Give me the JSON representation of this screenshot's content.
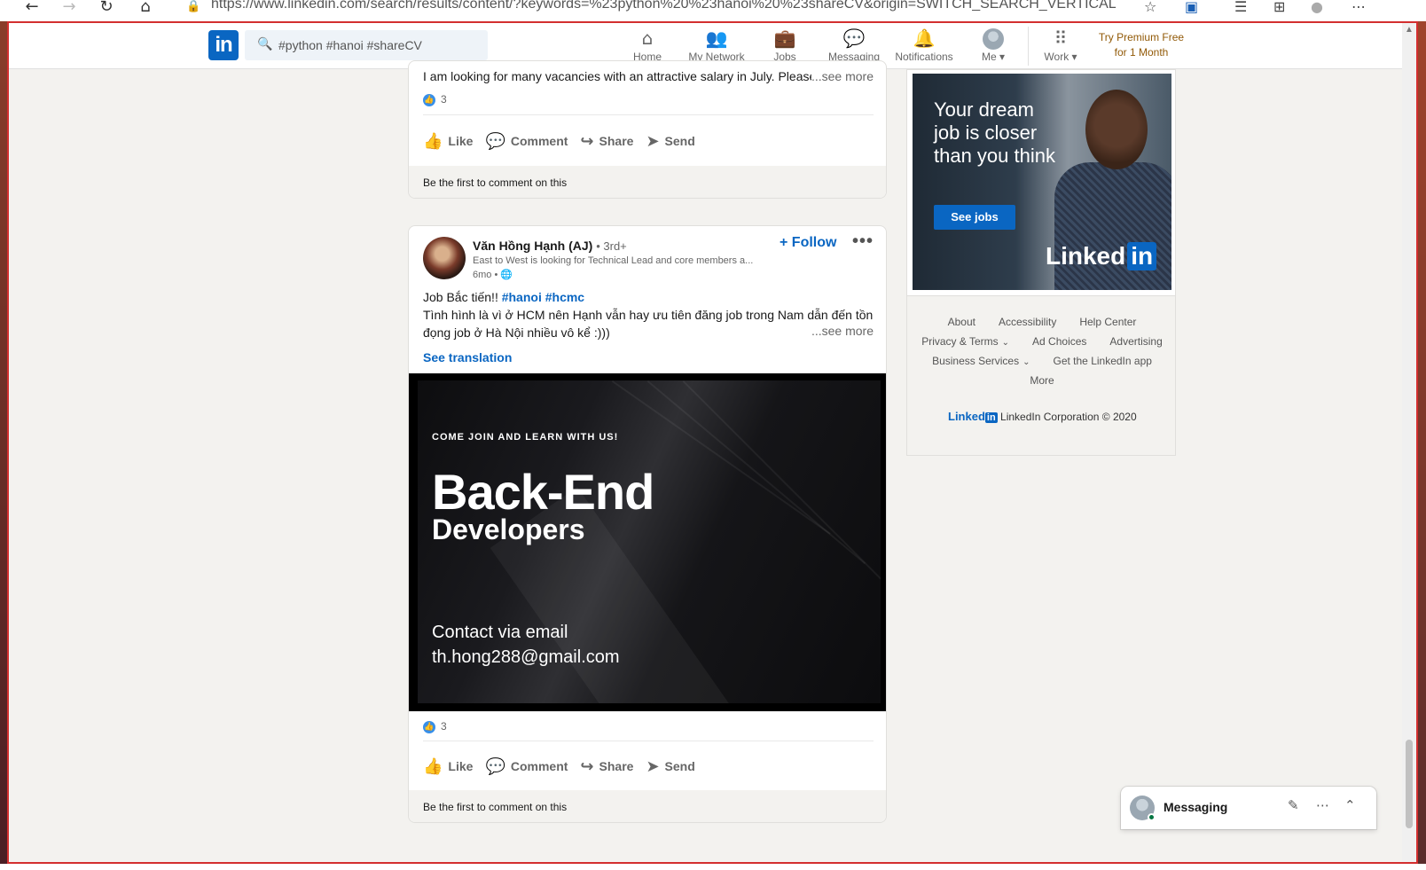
{
  "browser": {
    "url": "https://www.linkedin.com/search/results/content/?keywords=%23python%20%23hanoi%20%23shareCV&origin=SWITCH_SEARCH_VERTICAL"
  },
  "header": {
    "logo_text": "in",
    "search_value": "#python #hanoi #shareCV",
    "nav": {
      "home": "Home",
      "network": "My Network",
      "jobs": "Jobs",
      "messaging": "Messaging",
      "notifications": "Notifications",
      "me": "Me",
      "work": "Work"
    },
    "premium_line1": "Try Premium Free",
    "premium_line2": "for 1 Month"
  },
  "post1": {
    "snippet": "I am looking for many vacancies with an attractive salary in July. Please c",
    "see_more": "...see more",
    "reaction_count": "3",
    "comment_prompt": "Be the first to comment on this"
  },
  "actions": {
    "like": "Like",
    "comment": "Comment",
    "share": "Share",
    "send": "Send"
  },
  "post2": {
    "author_name": "Văn Hồng Hạnh (AJ)",
    "author_degree": "• 3rd+",
    "author_headline": "East to West is looking for Technical Lead and core members a...",
    "time": "6mo •",
    "follow": "Follow",
    "text_line1_prefix": "Job Bắc tiến!!",
    "tag1": "#hanoi",
    "tag2": "#hcmc",
    "text_line2": "Tình hình là vì ở HCM nên Hạnh vẫn hay ưu tiên đăng job trong Nam dẫn đến tồn",
    "text_line3": "đọng job ở Hà Nội nhiều vô kể :)))",
    "see_more": "...see more",
    "see_translation": "See translation",
    "image": {
      "kicker": "COME JOIN AND LEARN WITH US!",
      "title": "Back-End",
      "subtitle": "Developers",
      "contact_line1": "Contact  via email",
      "contact_line2": "th.hong288@gmail.com"
    },
    "reaction_count": "3",
    "comment_prompt": "Be the first to comment on this"
  },
  "ad": {
    "headline": "Your dream job is closer than you think",
    "cta": "See jobs",
    "brand_text": "Linked",
    "brand_in": "in"
  },
  "footer": {
    "about": "About",
    "accessibility": "Accessibility",
    "help_center": "Help Center",
    "privacy_terms": "Privacy & Terms",
    "ad_choices": "Ad Choices",
    "advertising": "Advertising",
    "business_services": "Business Services",
    "get_app": "Get the LinkedIn app",
    "more": "More",
    "brand_logo": "Linked",
    "brand_logo_in": "in",
    "copyright": "LinkedIn Corporation © 2020"
  },
  "messaging": {
    "title": "Messaging"
  },
  "colors": {
    "brand": "#0a66c2",
    "premium": "#915907",
    "window_border": "#d32f2f"
  }
}
